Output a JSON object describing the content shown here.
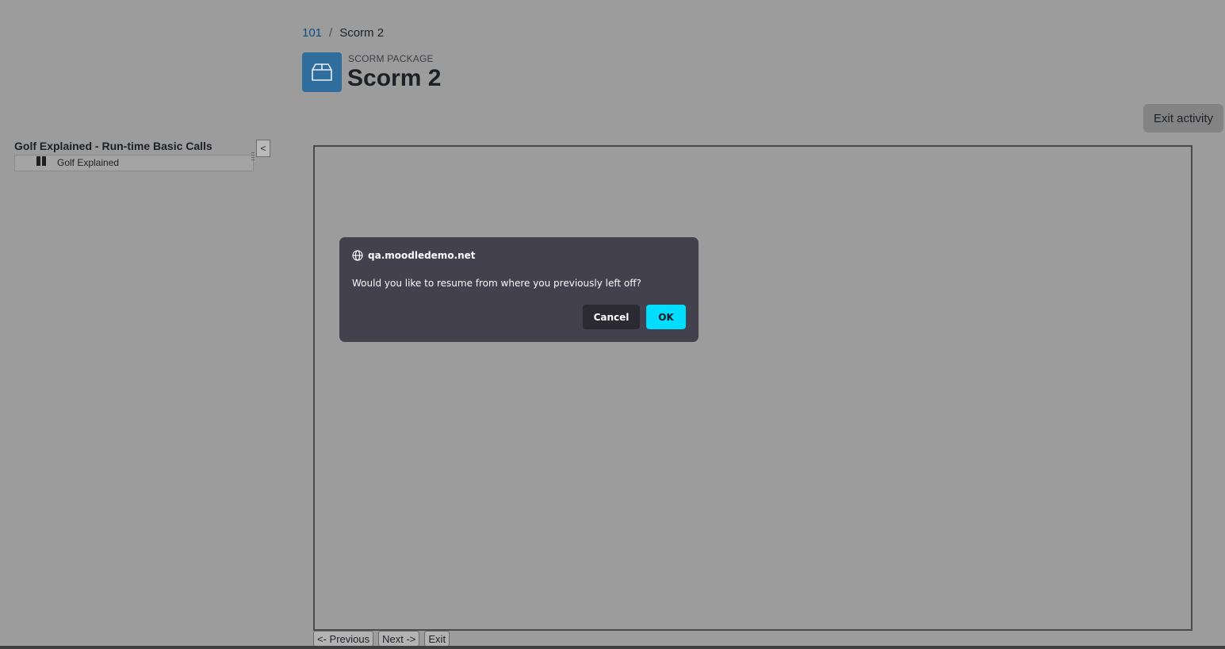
{
  "breadcrumb": {
    "course": "101",
    "separator": "/",
    "current": "Scorm 2"
  },
  "header": {
    "kicker": "SCORM PACKAGE",
    "title": "Scorm 2"
  },
  "actions": {
    "exit_activity": "Exit activity"
  },
  "toc": {
    "title": "Golf Explained - Run-time Basic Calls",
    "items": [
      {
        "label": "Golf Explained",
        "status_icon": "pause-icon"
      }
    ],
    "toggle": "<"
  },
  "nav": {
    "previous": "<- Previous",
    "next": "Next ->",
    "exit": "Exit"
  },
  "dialog": {
    "origin": "qa.moodledemo.net",
    "message": "Would you like to resume from where you previously left off?",
    "cancel": "Cancel",
    "ok": "OK"
  },
  "colors": {
    "ok_button": "#00ddff",
    "dialog_bg": "#42414d",
    "activity_icon_bg": "#2f6d9c"
  }
}
